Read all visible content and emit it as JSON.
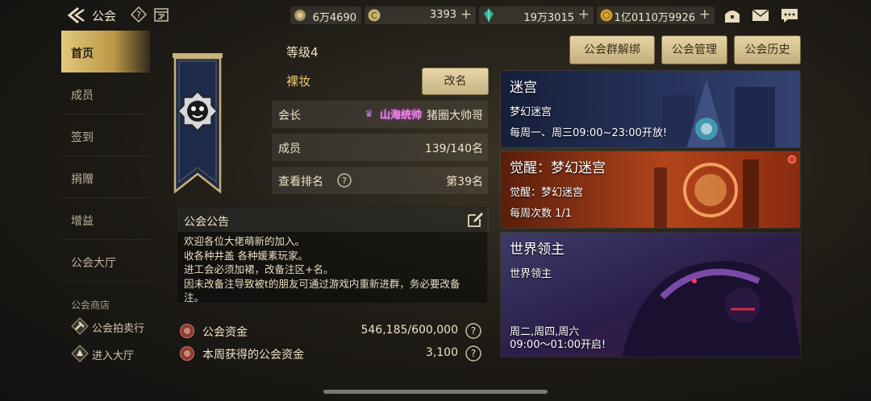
{
  "header": {
    "title": "公会",
    "resources": [
      {
        "icon": "gold-coin-icon",
        "value": "6万4690"
      },
      {
        "icon": "c-currency-icon",
        "value": "3393"
      },
      {
        "icon": "green-gem-icon",
        "value": "19万3015"
      },
      {
        "icon": "medal-coin-icon",
        "value": "1亿0110万9926"
      }
    ]
  },
  "sidebar": {
    "items": [
      {
        "label": "首页",
        "active": true
      },
      {
        "label": "成员"
      },
      {
        "label": "签到"
      },
      {
        "label": "捐赠"
      },
      {
        "label": "增益"
      },
      {
        "label": "公会大厅"
      }
    ],
    "shop_heading": "公会商店",
    "shop_links": [
      {
        "label": "公会拍卖行",
        "icon": "auction-hammer-icon"
      },
      {
        "label": "进入大厅",
        "icon": "hall-enter-icon"
      }
    ]
  },
  "guild": {
    "level": "等级4",
    "name": "裸妆",
    "rename_label": "改名",
    "leader_key": "会长",
    "leader_title": "山海统帅",
    "leader_name": "猪圈大帅哥",
    "members_key": "成员",
    "members_value": "139/140名",
    "rank_key": "查看排名",
    "rank_value": "第39名"
  },
  "announcement": {
    "title": "公会公告",
    "lines": [
      "欢迎各位大佬萌新的加入。",
      "收各种井盖 各种媛素玩家。",
      "进工会必须加裙，改备注区+名。",
      "因未改备注导致被t的朋友可通过游戏内重新进群，务必要改备",
      "注。"
    ]
  },
  "funds": [
    {
      "label": "公会资金",
      "value": "546,185/600,000"
    },
    {
      "label": "本周获得的公会资金",
      "value": "3,100"
    }
  ],
  "actions": {
    "unbind": "公会群解绑",
    "manage": "公会管理",
    "history": "公会历史"
  },
  "activities": [
    {
      "title": "迷宫",
      "subtitle": "梦幻迷宫",
      "detail": "每周一、周三09:00~23:00开放!"
    },
    {
      "title": "觉醒：梦幻迷宫",
      "subtitle": "觉醒：梦幻迷宫",
      "detail": "每周次数 1/1"
    },
    {
      "title": "世界领主",
      "subtitle": "世界领主",
      "detail": "周二,周四,周六",
      "detail2": "09:00～01:00开启!"
    }
  ]
}
